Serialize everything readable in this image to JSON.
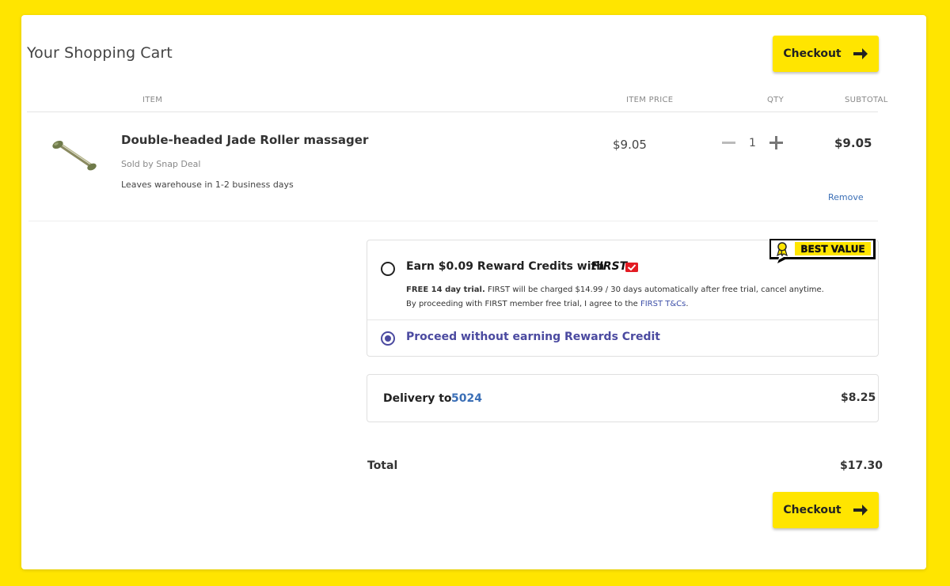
{
  "cart": {
    "title": "Your Shopping Cart",
    "checkout_label": "Checkout",
    "columns": {
      "item": "ITEM",
      "item_price": "ITEM PRICE",
      "qty": "QTY",
      "subtotal": "SUBTOTAL"
    },
    "items": [
      {
        "name": "Double-headed Jade Roller massager",
        "sold_by": "Sold by Snap Deal",
        "shipping": "Leaves warehouse in 1-2 business days",
        "price": "$9.05",
        "qty": "1",
        "subtotal": "$9.05",
        "remove_label": "Remove"
      }
    ]
  },
  "rewards": {
    "badge": "BEST VALUE",
    "option_earn": "Earn $0.09 Reward Credits with",
    "first_brand": "FIRST",
    "trial_bold": "FREE 14 day trial.",
    "trial_text": " FIRST will be charged $14.99 / 30 days automatically after free trial, cancel anytime.",
    "agree_text": "By proceeding with FIRST member free trial, I agree to the ",
    "tc_link": "FIRST T&Cs",
    "agree_end": ".",
    "option_skip": "Proceed without earning Rewards Credit",
    "selected": "skip"
  },
  "delivery": {
    "label": "Delivery to",
    "postcode": "5024",
    "price": "$8.25"
  },
  "total": {
    "label": "Total",
    "value": "$17.30"
  },
  "colors": {
    "brand_yellow": "#ffe500",
    "link_blue": "#3b6fb6",
    "radio_purple": "#4b4aa0",
    "first_red": "#e31b23"
  }
}
